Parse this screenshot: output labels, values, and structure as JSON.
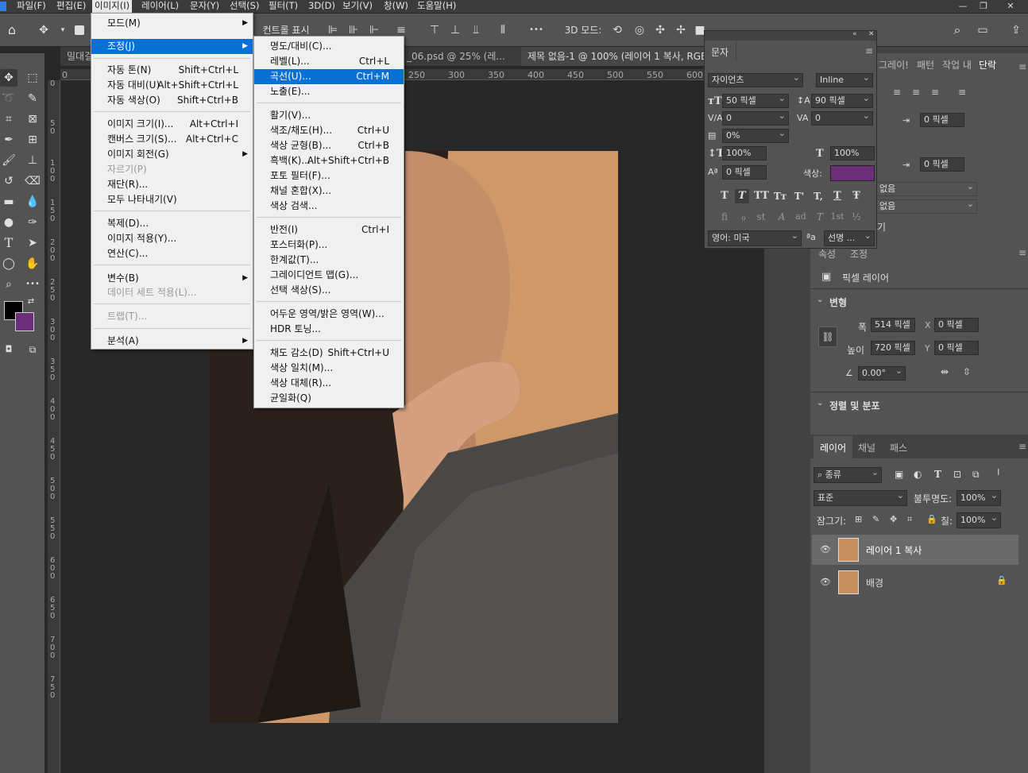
{
  "menubar": {
    "items": [
      "파일(F)",
      "편집(E)",
      "이미지(I)",
      "레이어(L)",
      "문자(Y)",
      "선택(S)",
      "필터(T)",
      "3D(D)",
      "보기(V)",
      "창(W)",
      "도움말(H)"
    ]
  },
  "window_controls": {
    "minimize": "—",
    "restore": "❐",
    "close": "✕"
  },
  "options": {
    "mode_3d_label": "3D 모드:",
    "more": "•••",
    "controls_label": "컨트롤 표시"
  },
  "tabs": [
    {
      "label": "밀대걸레..."
    },
    {
      "label": "_06.psd @ 25% (레..."
    },
    {
      "label": "제목 없음-1 @ 100% (레이어 1 복사, RGB/8)",
      "close": "✕"
    }
  ],
  "ruler_top": [
    "0",
    "250",
    "300",
    "350",
    "400",
    "450",
    "500",
    "550",
    "600"
  ],
  "ruler_left": [
    "0",
    "5\n0",
    "1\n0\n0",
    "1\n5\n0",
    "2\n0\n0",
    "2\n5\n0",
    "3\n0\n0",
    "3\n5\n0",
    "4\n0\n0",
    "4\n5\n0",
    "5\n0\n0",
    "5\n5\n0",
    "6\n0\n0",
    "6\n5\n0",
    "7\n0\n0",
    "7\n5\n0"
  ],
  "colors": {
    "foreground": "#000000",
    "background": "#6b2f7a",
    "text_color_swatch": "#6b2f7a",
    "highlight": "#0a70d6",
    "photo_bg": "#d19a6a"
  },
  "image_menu": {
    "items": [
      {
        "label": "모드(M)",
        "shortcut": "",
        "submenu": true
      },
      {
        "label": "조정(J)",
        "shortcut": "",
        "submenu": true,
        "highlighted": true
      },
      {
        "label": "자동 톤(N)",
        "shortcut": "Shift+Ctrl+L"
      },
      {
        "label": "자동 대비(U)",
        "shortcut": "Alt+Shift+Ctrl+L"
      },
      {
        "label": "자동 색상(O)",
        "shortcut": "Shift+Ctrl+B"
      },
      {
        "label": "이미지 크기(I)...",
        "shortcut": "Alt+Ctrl+I"
      },
      {
        "label": "캔버스 크기(S)...",
        "shortcut": "Alt+Ctrl+C"
      },
      {
        "label": "이미지 회전(G)",
        "shortcut": "",
        "submenu": true
      },
      {
        "label": "자르기(P)",
        "shortcut": "",
        "disabled": true
      },
      {
        "label": "재단(R)...",
        "shortcut": ""
      },
      {
        "label": "모두 나타내기(V)",
        "shortcut": ""
      },
      {
        "label": "복제(D)...",
        "shortcut": ""
      },
      {
        "label": "이미지 적용(Y)...",
        "shortcut": ""
      },
      {
        "label": "연산(C)...",
        "shortcut": ""
      },
      {
        "label": "변수(B)",
        "shortcut": "",
        "submenu": true
      },
      {
        "label": "데이터 세트 적용(L)...",
        "shortcut": "",
        "disabled": true
      },
      {
        "label": "트랩(T)...",
        "shortcut": "",
        "disabled": true
      },
      {
        "label": "분석(A)",
        "shortcut": "",
        "submenu": true
      }
    ]
  },
  "adjust_menu": {
    "items": [
      {
        "label": "명도/대비(C)...",
        "shortcut": ""
      },
      {
        "label": "레벨(L)...",
        "shortcut": "Ctrl+L"
      },
      {
        "label": "곡선(U)...",
        "shortcut": "Ctrl+M",
        "highlighted": true
      },
      {
        "label": "노출(E)...",
        "shortcut": ""
      },
      {
        "label": "활기(V)...",
        "shortcut": ""
      },
      {
        "label": "색조/채도(H)...",
        "shortcut": "Ctrl+U"
      },
      {
        "label": "색상 균형(B)...",
        "shortcut": "Ctrl+B"
      },
      {
        "label": "흑백(K)...",
        "shortcut": "Alt+Shift+Ctrl+B"
      },
      {
        "label": "포토 필터(F)...",
        "shortcut": ""
      },
      {
        "label": "채널 혼합(X)...",
        "shortcut": ""
      },
      {
        "label": "색상 검색...",
        "shortcut": ""
      },
      {
        "label": "반전(I)",
        "shortcut": "Ctrl+I"
      },
      {
        "label": "포스터화(P)...",
        "shortcut": ""
      },
      {
        "label": "한계값(T)...",
        "shortcut": ""
      },
      {
        "label": "그레이디언트 맵(G)...",
        "shortcut": ""
      },
      {
        "label": "선택 색상(S)...",
        "shortcut": ""
      },
      {
        "label": "어두운 영역/밝은 영역(W)...",
        "shortcut": ""
      },
      {
        "label": "HDR 토닝...",
        "shortcut": ""
      },
      {
        "label": "채도 감소(D)",
        "shortcut": "Shift+Ctrl+U"
      },
      {
        "label": "색상 일치(M)...",
        "shortcut": ""
      },
      {
        "label": "색상 대체(R)...",
        "shortcut": ""
      },
      {
        "label": "균일화(Q)",
        "shortcut": ""
      }
    ]
  },
  "char_panel": {
    "title": "문자",
    "font_family": "자이언츠",
    "font_style": "Inline",
    "font_size": "50 픽셀",
    "leading": "90 픽셀",
    "kerning": "0",
    "tracking": "0",
    "scale_pct": "0%",
    "vscale": "100%",
    "hscale": "100%",
    "baseline": "0 픽셀",
    "color_label": "색상:",
    "language": "영어: 미국",
    "aa_icon_text": "ªa",
    "antialias": "선명 ...",
    "style_buttons": [
      "T",
      "T",
      "TT",
      "Tт",
      "T'",
      "T,",
      "T",
      "Ŧ"
    ],
    "opentype_buttons": [
      "fi",
      "ℴ",
      "st",
      "A",
      "ad",
      "T",
      "1st",
      "½"
    ]
  },
  "right_panel": {
    "tabs": [
      "그레이!",
      "패턴",
      "작업 내",
      "단락"
    ],
    "indent_1": "0 픽셀",
    "indent_2": "0 픽셀",
    "hyphen_1": "없음",
    "hyphen_2": "없음",
    "tail_char": "기"
  },
  "properties": {
    "tabs": [
      "속성",
      "조정"
    ],
    "layer_type": "픽셀 레이어",
    "transform_header": "변형",
    "width_label": "폭",
    "width": "514 픽셀",
    "x_label": "X",
    "x": "0 픽셀",
    "height_label": "높이",
    "height": "720 픽셀",
    "y_label": "Y",
    "y": "0 픽셀",
    "angle": "0.00°",
    "align_header": "정렬 및 분포"
  },
  "layers": {
    "tabs": [
      "레이어",
      "채널",
      "패스"
    ],
    "filter_kind": "종류",
    "blend_mode": "표준",
    "opacity_label": "불투명도:",
    "opacity": "100%",
    "lock_label": "잠그기:",
    "fill_label": "칠:",
    "fill": "100%",
    "items": [
      {
        "name": "레이어 1 복사",
        "selected": true
      },
      {
        "name": "배경",
        "locked": true
      }
    ]
  }
}
